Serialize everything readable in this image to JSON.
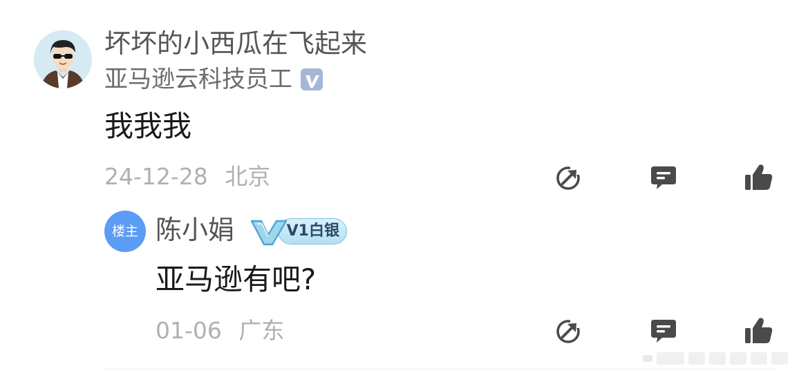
{
  "comment": {
    "username": "坏坏的小西瓜在飞起来",
    "subtitle": "亚马逊云科技员工",
    "verified_badge": "V",
    "text": "我我我",
    "date": "24-12-28",
    "location": "北京",
    "actions": [
      "share-icon",
      "comment-icon",
      "like-icon"
    ]
  },
  "reply": {
    "op_badge": "楼主",
    "name": "陈小娟",
    "level_badge": "V1白银",
    "text": "亚马逊有吧?",
    "date": "01-06",
    "location": "广东",
    "actions": [
      "share-icon",
      "comment-icon",
      "like-icon"
    ]
  },
  "colors": {
    "op_badge": "#5b9cf4",
    "verified_badge": "#a6b7d6",
    "icon": "#4a4a4a",
    "muted_text": "#b0b0b0"
  }
}
